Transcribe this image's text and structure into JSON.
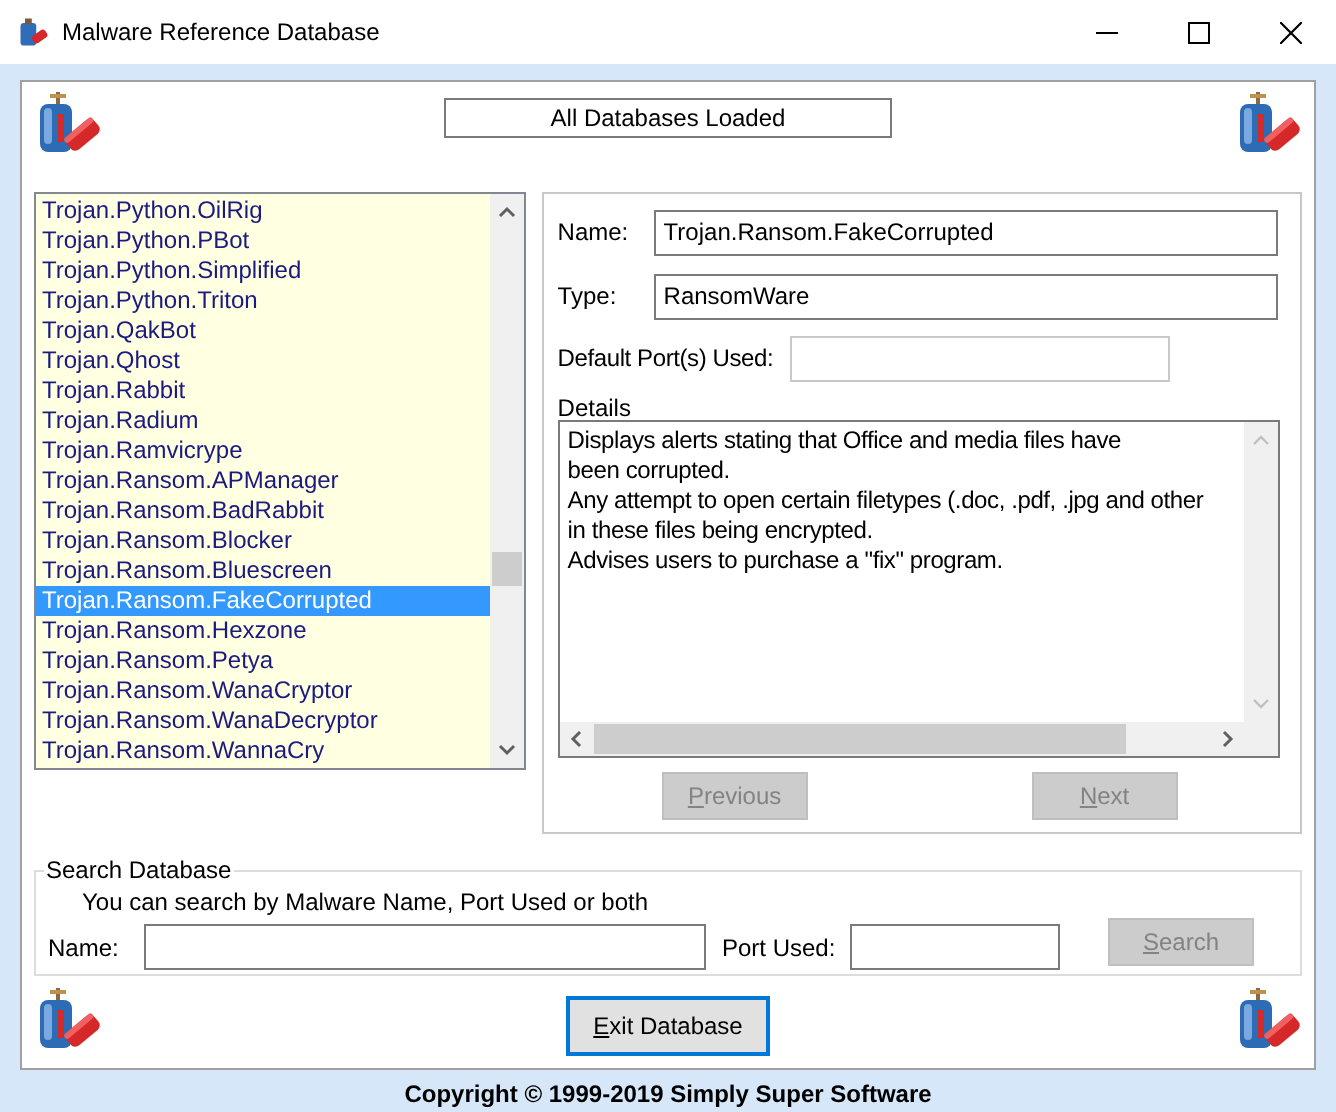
{
  "window": {
    "title": "Malware Reference Database"
  },
  "status": "All Databases Loaded",
  "malware_list": [
    {
      "label": "Trojan.Python.OilRig",
      "selected": false
    },
    {
      "label": "Trojan.Python.PBot",
      "selected": false
    },
    {
      "label": "Trojan.Python.Simplified",
      "selected": false
    },
    {
      "label": "Trojan.Python.Triton",
      "selected": false
    },
    {
      "label": "Trojan.QakBot",
      "selected": false
    },
    {
      "label": "Trojan.Qhost",
      "selected": false
    },
    {
      "label": "Trojan.Rabbit",
      "selected": false
    },
    {
      "label": "Trojan.Radium",
      "selected": false
    },
    {
      "label": "Trojan.Ramvicrype",
      "selected": false
    },
    {
      "label": "Trojan.Ransom.APManager",
      "selected": false
    },
    {
      "label": "Trojan.Ransom.BadRabbit",
      "selected": false
    },
    {
      "label": "Trojan.Ransom.Blocker",
      "selected": false
    },
    {
      "label": "Trojan.Ransom.Bluescreen",
      "selected": false
    },
    {
      "label": "Trojan.Ransom.FakeCorrupted",
      "selected": true
    },
    {
      "label": "Trojan.Ransom.Hexzone",
      "selected": false
    },
    {
      "label": "Trojan.Ransom.Petya",
      "selected": false
    },
    {
      "label": "Trojan.Ransom.WanaCryptor",
      "selected": false
    },
    {
      "label": "Trojan.Ransom.WanaDecryptor",
      "selected": false
    },
    {
      "label": "Trojan.Ransom.WannaCry",
      "selected": false
    }
  ],
  "details_panel": {
    "name_label": "Name:",
    "name_value": "Trojan.Ransom.FakeCorrupted",
    "type_label": "Type:",
    "type_value": "RansomWare",
    "port_label": "Default Port(s) Used:",
    "details_label": "Details",
    "details_lines": [
      "Displays alerts stating that Office and media files have",
      "been corrupted.",
      "Any attempt to open certain filetypes (.doc, .pdf, .jpg and other",
      "in these files being encrypted.",
      "Advises users to purchase a \"fix\" program."
    ],
    "buttons": [
      {
        "label": "Previous",
        "disabled": true
      },
      {
        "label": "Next",
        "disabled": true
      }
    ]
  },
  "search": {
    "title": "Search Database",
    "hint": "You can search by Malware Name, Port Used or both",
    "name_label": "Name:",
    "port_label": "Port Used:",
    "button": {
      "label": "Search",
      "disabled": true
    }
  },
  "exit_button": {
    "label": "Exit Database",
    "focused": true
  },
  "copyright": "Copyright © 1999-2019 Simply Super Software"
}
